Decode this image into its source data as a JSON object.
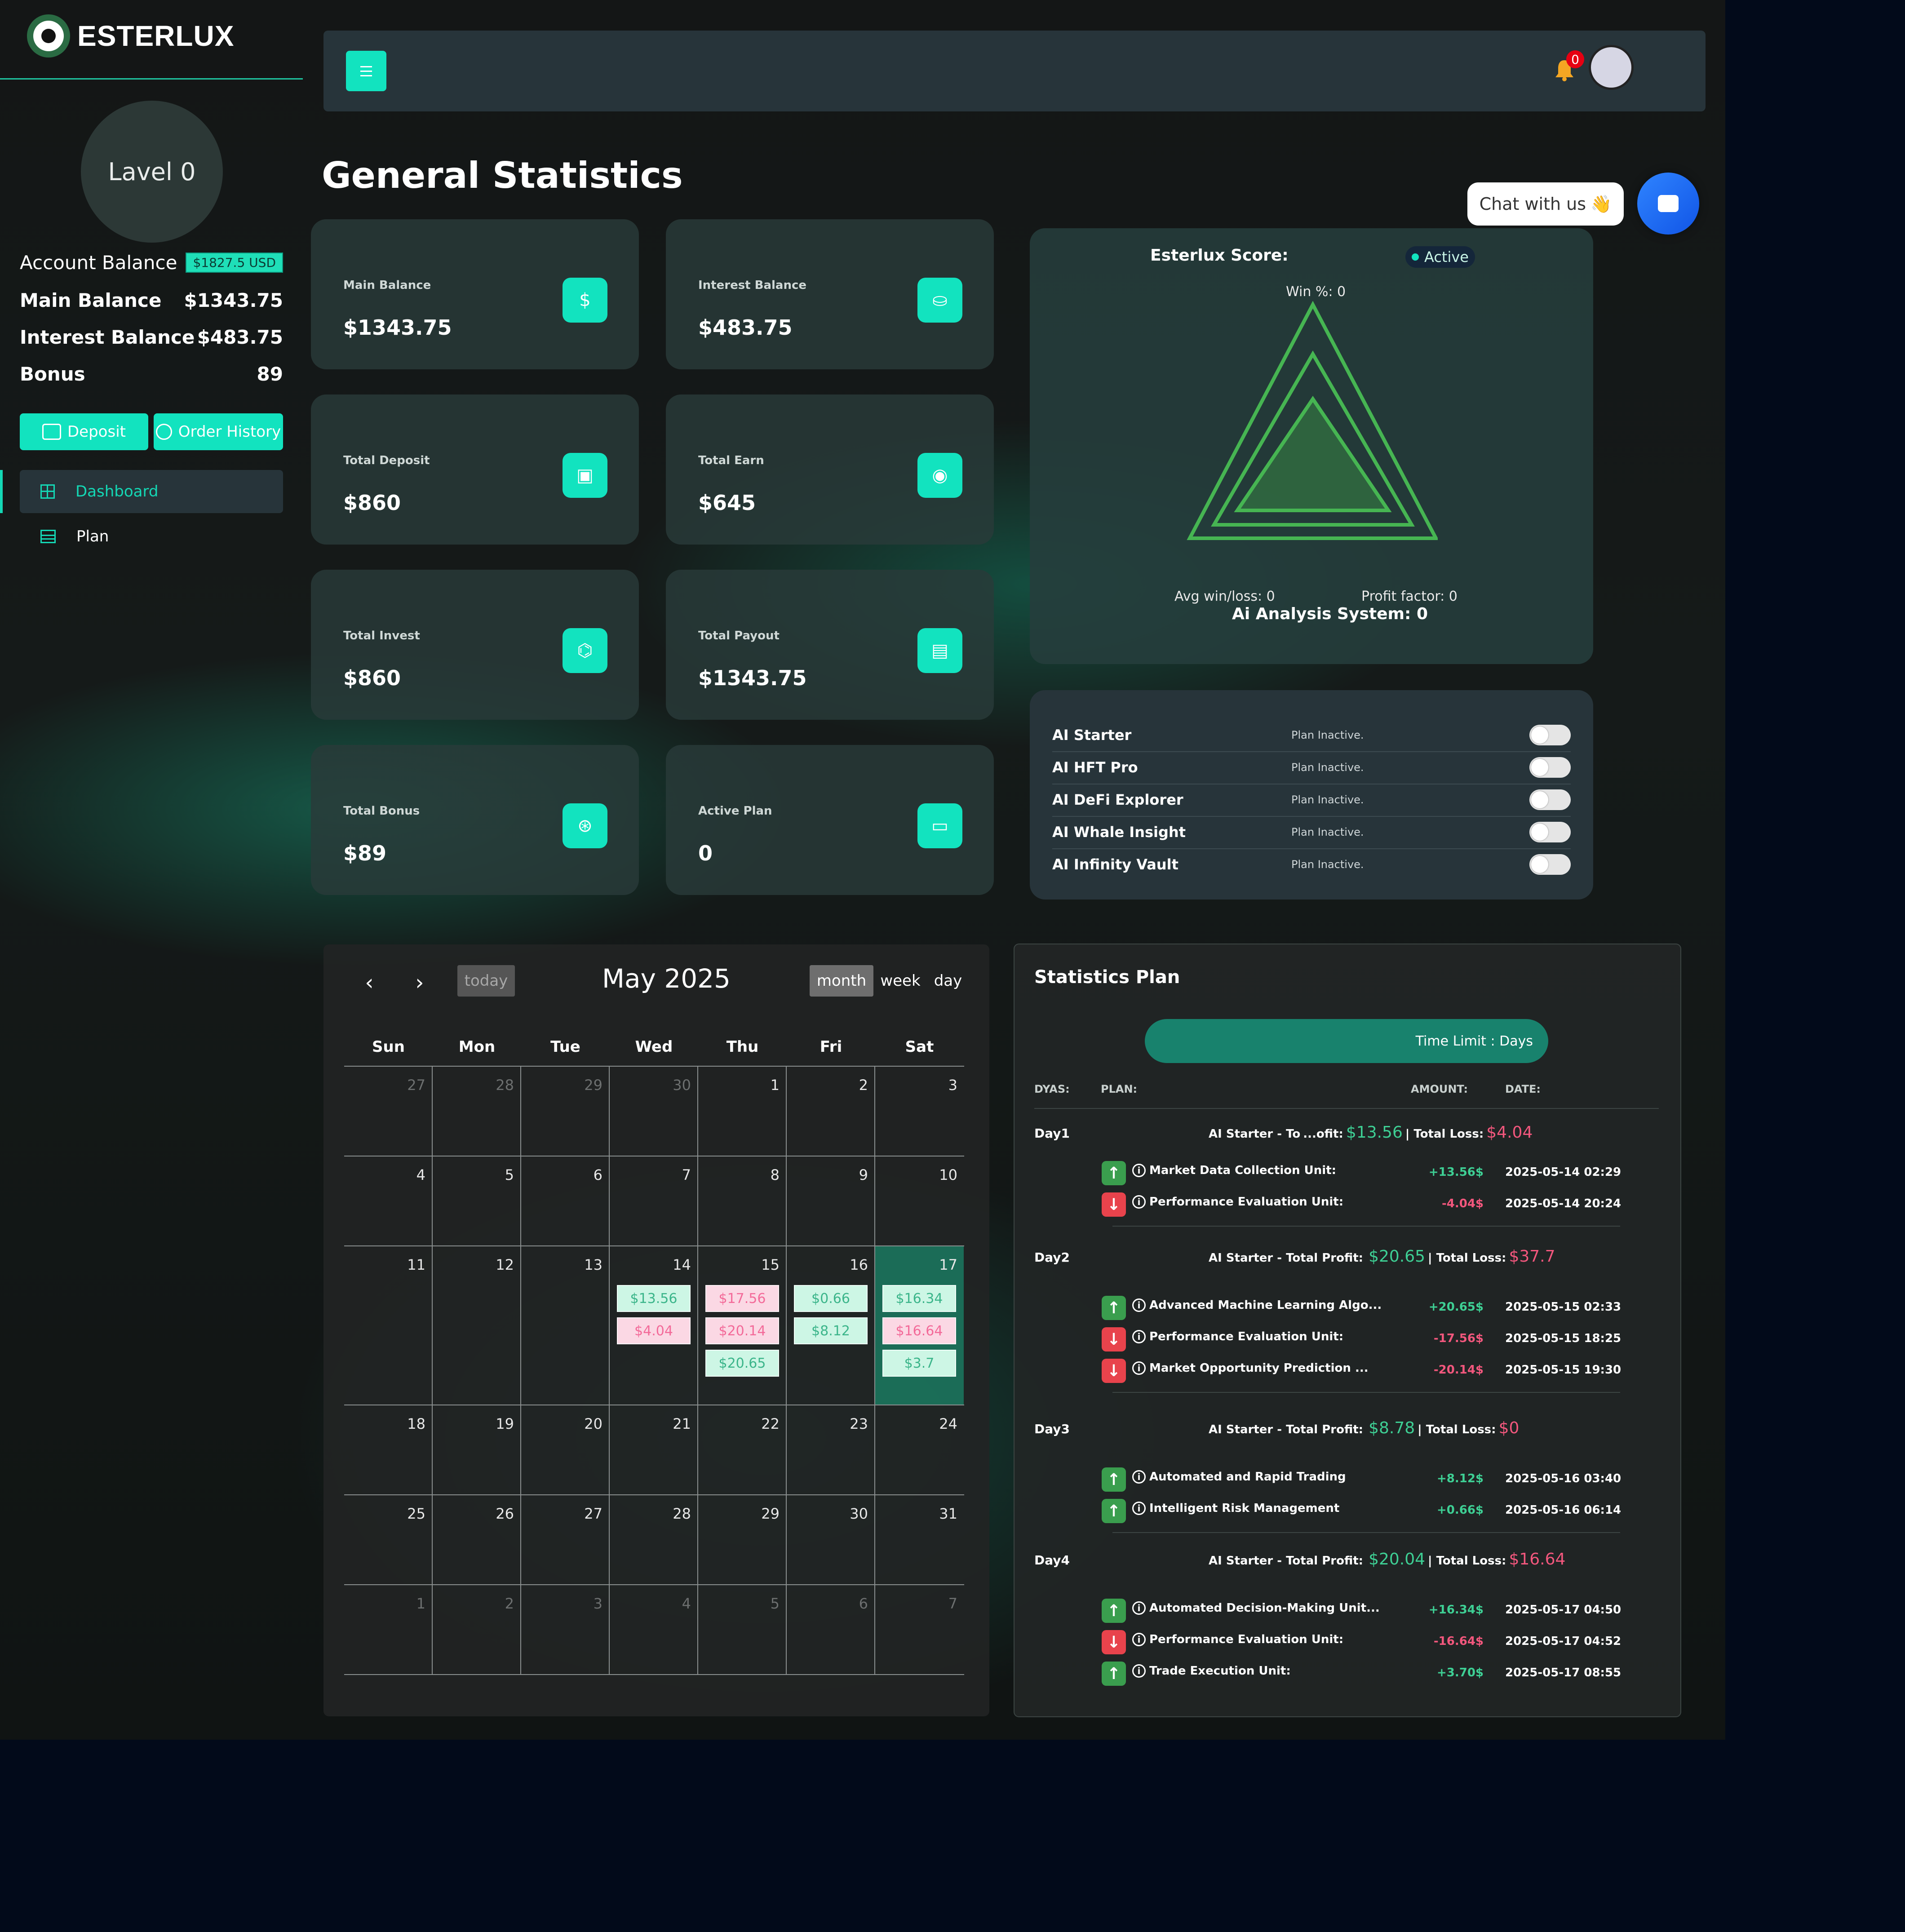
{
  "brand": {
    "name": "ESTERLUX"
  },
  "sidebar": {
    "level": "Lavel 0",
    "account_balance_label": "Account Balance",
    "account_balance_badge": "$1827.5 USD",
    "rows": [
      {
        "label": "Main Balance",
        "value": "$1343.75"
      },
      {
        "label": "Interest Balance",
        "value": "$483.75"
      },
      {
        "label": "Bonus",
        "value": "89"
      }
    ],
    "deposit_label": "Deposit",
    "order_history_label": "Order History",
    "nav": [
      {
        "label": "Dashboard",
        "icon": "grid-icon",
        "active": true
      },
      {
        "label": "Plan",
        "icon": "list-icon",
        "active": false
      }
    ]
  },
  "header": {
    "notification_count": "0"
  },
  "page_title": "General Statistics",
  "chat": {
    "label": "Chat with us",
    "emoji": "👋"
  },
  "cards": [
    {
      "label": "Main Balance",
      "value": "$1343.75",
      "icon": "$"
    },
    {
      "label": "Interest Balance",
      "value": "$483.75",
      "icon": "⛀"
    },
    {
      "label": "Total Deposit",
      "value": "$860",
      "icon": "▣"
    },
    {
      "label": "Total Earn",
      "value": "$645",
      "icon": "◉"
    },
    {
      "label": "Total Invest",
      "value": "$860",
      "icon": "⌬"
    },
    {
      "label": "Total Payout",
      "value": "$1343.75",
      "icon": "▤"
    },
    {
      "label": "Total Bonus",
      "value": "$89",
      "icon": "⊛"
    },
    {
      "label": "Active Plan",
      "value": "0",
      "icon": "▭"
    }
  ],
  "score": {
    "label": "Esterlux Score:",
    "status": "Active",
    "win": "Win %: 0",
    "avg": "Avg win/loss: 0",
    "profit_factor": "Profit factor: 0",
    "analysis": "Ai Analysis System: 0"
  },
  "plans": [
    {
      "name": "AI Starter",
      "status": "Plan Inactive."
    },
    {
      "name": "AI HFT Pro",
      "status": "Plan Inactive."
    },
    {
      "name": "AI DeFi Explorer",
      "status": "Plan Inactive."
    },
    {
      "name": "AI Whale Insight",
      "status": "Plan Inactive."
    },
    {
      "name": "AI Infinity Vault",
      "status": "Plan Inactive."
    }
  ],
  "calendar": {
    "title": "May 2025",
    "today": "today",
    "views": [
      "month",
      "week",
      "day"
    ],
    "prev": "‹",
    "next": "›",
    "weekdays": [
      "Sun",
      "Mon",
      "Tue",
      "Wed",
      "Thu",
      "Fri",
      "Sat"
    ],
    "weeks": [
      [
        "27",
        "28",
        "29",
        "30",
        "1",
        "2",
        "3"
      ],
      [
        "4",
        "5",
        "6",
        "7",
        "8",
        "9",
        "10"
      ],
      [
        "11",
        "12",
        "13",
        "14",
        "15",
        "16",
        "17"
      ],
      [
        "18",
        "19",
        "20",
        "21",
        "22",
        "23",
        "24"
      ],
      [
        "25",
        "26",
        "27",
        "28",
        "29",
        "30",
        "31"
      ],
      [
        "1",
        "2",
        "3",
        "4",
        "5",
        "6",
        "7"
      ]
    ],
    "events": {
      "14": [
        {
          "t": "$13.56",
          "k": "g"
        },
        {
          "t": "$4.04",
          "k": "r"
        }
      ],
      "15": [
        {
          "t": "$17.56",
          "k": "r"
        },
        {
          "t": "$20.14",
          "k": "r"
        },
        {
          "t": "$20.65",
          "k": "g"
        }
      ],
      "16": [
        {
          "t": "$0.66",
          "k": "g"
        },
        {
          "t": "$8.12",
          "k": "g"
        }
      ],
      "17": [
        {
          "t": "$16.34",
          "k": "g"
        },
        {
          "t": "$16.64",
          "k": "r"
        },
        {
          "t": "$3.7",
          "k": "g"
        }
      ]
    }
  },
  "stats_plan": {
    "title": "Statistics Plan",
    "time_limit": "Time Limit : Days",
    "columns": {
      "days": "DYAS:",
      "plan": "PLAN:",
      "amount": "AMOUNT:",
      "date": "DATE:"
    },
    "days": [
      {
        "label": "Day1",
        "summary_prefix": "AI Starter - To",
        "summary_mid": "...ofit:",
        "profit": "$13.56",
        "loss_label": "| Total Loss:",
        "loss": "$4.04",
        "txns": [
          {
            "dir": "up",
            "name": "Market Data Collection Unit:",
            "amount": "+13.56$",
            "date": "2025-05-14 02:29"
          },
          {
            "dir": "dn",
            "name": "Performance Evaluation Unit:",
            "amount": "-4.04$",
            "date": "2025-05-14 20:24"
          }
        ]
      },
      {
        "label": "Day2",
        "summary_prefix": "AI Starter - Total Profit:",
        "summary_mid": "",
        "profit": "$20.65",
        "loss_label": "| Total Loss:",
        "loss": "$37.7",
        "txns": [
          {
            "dir": "up",
            "name": "Advanced Machine Learning Algo...",
            "amount": "+20.65$",
            "date": "2025-05-15 02:33"
          },
          {
            "dir": "dn",
            "name": "Performance Evaluation Unit:",
            "amount": "-17.56$",
            "date": "2025-05-15 18:25"
          },
          {
            "dir": "dn",
            "name": "Market Opportunity Prediction ...",
            "amount": "-20.14$",
            "date": "2025-05-15 19:30"
          }
        ]
      },
      {
        "label": "Day3",
        "summary_prefix": "AI Starter - Total Profit:",
        "summary_mid": "",
        "profit": "$8.78",
        "loss_label": "| Total Loss:",
        "loss": "$0",
        "txns": [
          {
            "dir": "up",
            "name": "Automated and Rapid Trading",
            "amount": "+8.12$",
            "date": "2025-05-16 03:40"
          },
          {
            "dir": "up",
            "name": "Intelligent Risk Management",
            "amount": "+0.66$",
            "date": "2025-05-16 06:14"
          }
        ]
      },
      {
        "label": "Day4",
        "summary_prefix": "AI Starter - Total Profit:",
        "summary_mid": "",
        "profit": "$20.04",
        "loss_label": "| Total Loss:",
        "loss": "$16.64",
        "txns": [
          {
            "dir": "up",
            "name": "Automated Decision-Making Unit...",
            "amount": "+16.34$",
            "date": "2025-05-17 04:50"
          },
          {
            "dir": "dn",
            "name": "Performance Evaluation Unit:",
            "amount": "-16.64$",
            "date": "2025-05-17 04:52"
          },
          {
            "dir": "up",
            "name": "Trade Execution Unit:",
            "amount": "+3.70$",
            "date": "2025-05-17 08:55"
          }
        ]
      }
    ]
  }
}
